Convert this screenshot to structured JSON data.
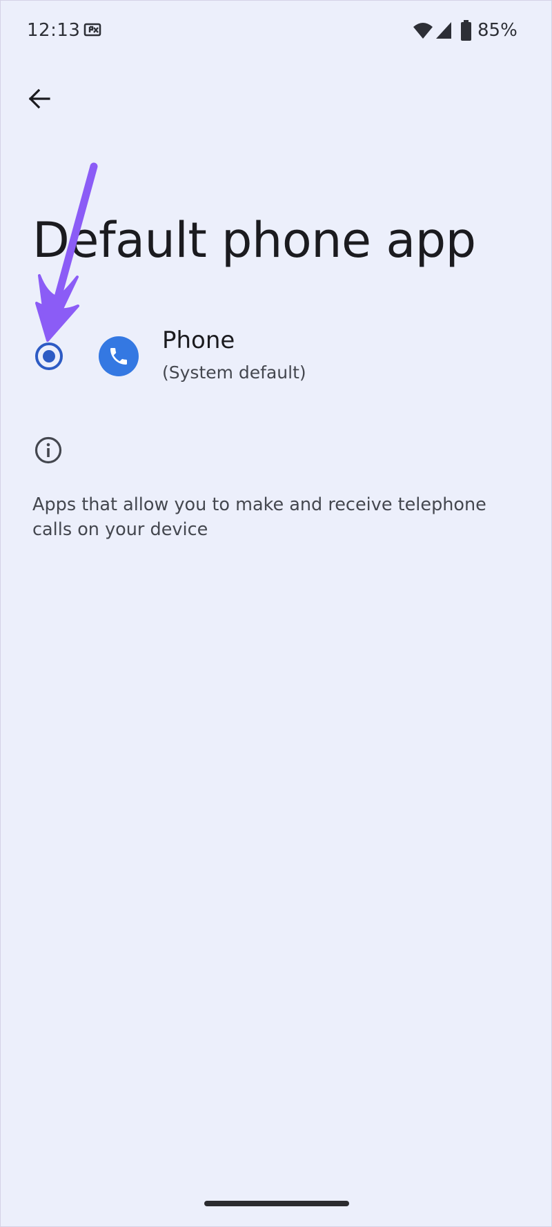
{
  "status_bar": {
    "time": "12:13",
    "battery": "85%",
    "icons": [
      "notification-icon",
      "wifi-icon",
      "cell-signal-icon",
      "battery-icon"
    ]
  },
  "header": {
    "back_icon": "arrow-back-icon",
    "title": "Default phone app"
  },
  "options": [
    {
      "name": "Phone",
      "subtitle": "(System default)",
      "selected": true,
      "icon": "phone-icon"
    }
  ],
  "info": {
    "icon": "info-icon",
    "text": "Apps that allow you to make and receive telephone calls on your device"
  },
  "colors": {
    "background": "#ECEFFB",
    "accent": "#2D5BC4",
    "app_icon_bg": "#3478E2",
    "annotation_arrow": "#8B5CF6"
  }
}
